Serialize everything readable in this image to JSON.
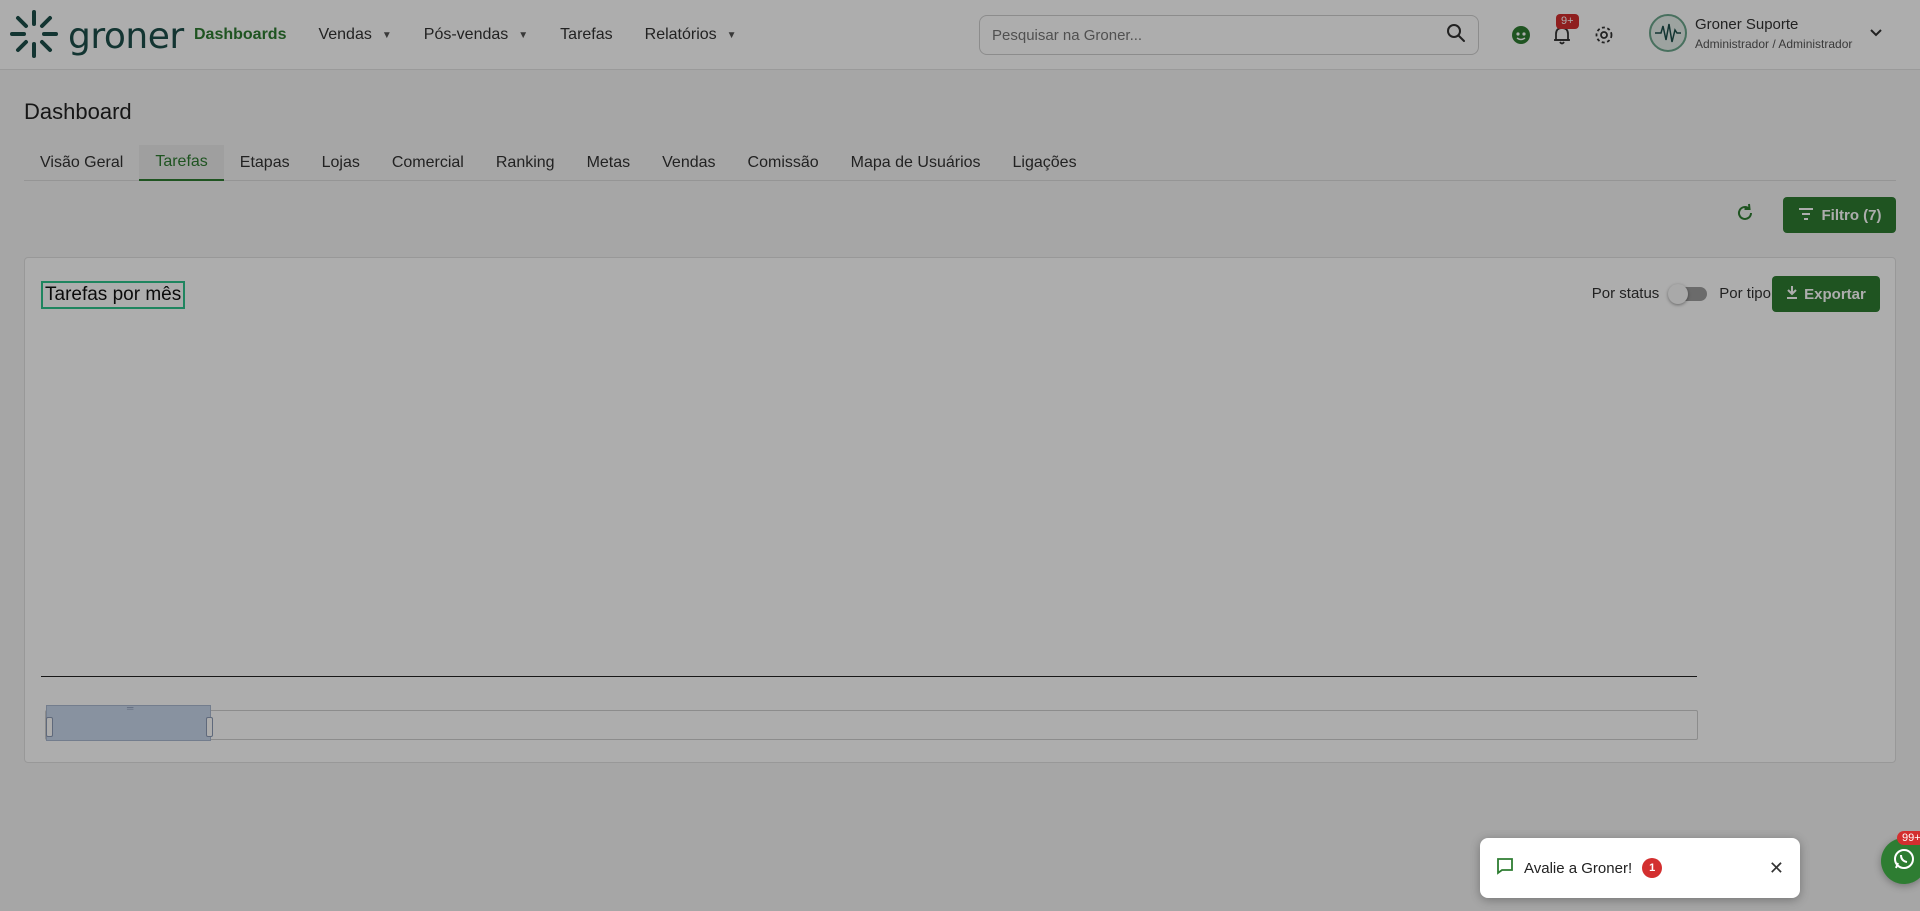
{
  "header": {
    "logo_text": "groner",
    "nav": [
      {
        "label": "Dashboards",
        "active": true,
        "dropdown": false
      },
      {
        "label": "Vendas",
        "active": false,
        "dropdown": true
      },
      {
        "label": "Pós-vendas",
        "active": false,
        "dropdown": true
      },
      {
        "label": "Tarefas",
        "active": false,
        "dropdown": false
      },
      {
        "label": "Relatórios",
        "active": false,
        "dropdown": true
      }
    ],
    "search_placeholder": "Pesquisar na Groner...",
    "notifications_badge": "9+",
    "user_name": "Groner Suporte",
    "user_role": "Administrador / Administrador"
  },
  "page": {
    "title": "Dashboard",
    "tabs": [
      "Visão Geral",
      "Tarefas",
      "Etapas",
      "Lojas",
      "Comercial",
      "Ranking",
      "Metas",
      "Vendas",
      "Comissão",
      "Mapa de Usuários",
      "Ligações"
    ],
    "active_tab": "Tarefas",
    "filter_label": "Filtro (7)"
  },
  "card": {
    "title": "Tarefas por mês",
    "toggle_left": "Por status",
    "toggle_right": "Por tipo",
    "export_label": "Exportar"
  },
  "toast": {
    "text": "Avalie a Groner!",
    "badge": "1"
  },
  "whatsapp_badge": "99+",
  "colors": {
    "brand_green": "#2e7d32",
    "logo_dark": "#1d4e4a",
    "alert_red": "#d32f2f",
    "focus_outline": "#2ec48c"
  }
}
